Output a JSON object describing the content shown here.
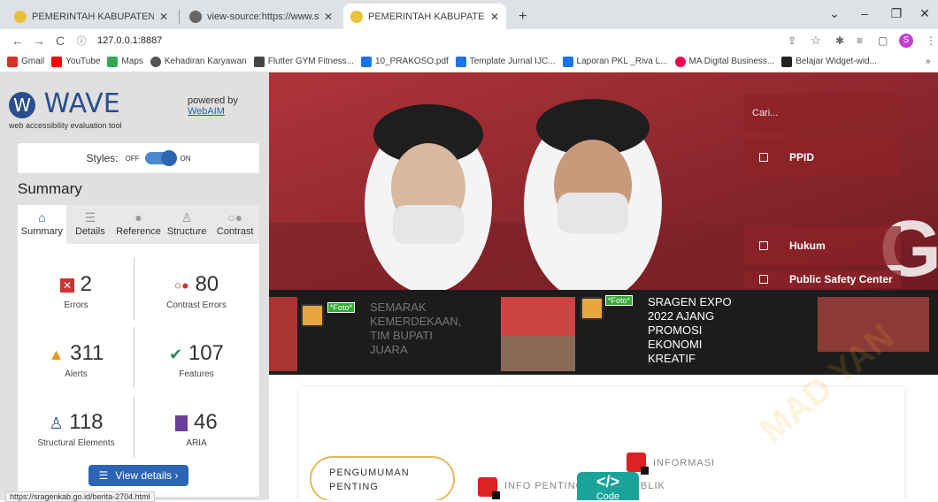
{
  "browser": {
    "tabs": [
      {
        "title": "PEMERINTAH KABUPATEN SRAGE"
      },
      {
        "title": "view-source:https://www.sragenk"
      },
      {
        "title": "PEMERINTAH KABUPATEN SRAGE"
      }
    ],
    "new_tab": "+",
    "url": "127.0.0.1:8887",
    "bookmarks": [
      "Gmail",
      "YouTube",
      "Maps",
      "Kehadiran Karyawan",
      "Flutter GYM Fitness...",
      "10_PRAKOSO.pdf",
      "Template Jurnal IJC...",
      "Laporan PKL _Riva L...",
      "MA Digital Business...",
      "Belajar Widget-wid..."
    ],
    "profile_initial": "S",
    "status_url": "https://sragenkab.go.id/berita-2704.html"
  },
  "wave": {
    "logo": "WAVE",
    "subtitle": "web accessibility evaluation tool",
    "powered_by": "powered by",
    "webaim": "WebAIM",
    "styles_label": "Styles:",
    "off": "OFF",
    "on": "ON",
    "summary_title": "Summary",
    "tabs": [
      "Summary",
      "Details",
      "Reference",
      "Structure",
      "Contrast"
    ],
    "stats": {
      "errors": {
        "value": "2",
        "label": "Errors"
      },
      "contrast": {
        "value": "80",
        "label": "Contrast Errors"
      },
      "alerts": {
        "value": "311",
        "label": "Alerts"
      },
      "features": {
        "value": "107",
        "label": "Features"
      },
      "structural": {
        "value": "118",
        "label": "Structural Elements"
      },
      "aria": {
        "value": "46",
        "label": "ARIA"
      }
    },
    "view_details": "View details ›"
  },
  "site": {
    "search_placeholder": "Cari...",
    "side_items": [
      "PPID",
      "Hukum",
      "Public Safety Center"
    ],
    "foto_tag": "*Foto*",
    "news1": [
      "SEMARAK",
      "KEMERDEKAAN,",
      "TIM BUPATI",
      "JUARA"
    ],
    "news2": [
      "SRAGEN EXPO",
      "2022 AJANG",
      "PROMOSI",
      "EKONOMI",
      "KREATIF"
    ],
    "pengumuman": [
      "PENGUMUMAN",
      "PENTING"
    ],
    "info_penting": "INFO PENTING",
    "informasi": "INFORMASI",
    "blik": "BLIK",
    "code": "Code",
    "code_glyph": "</>",
    "watermark": "MAD YAN"
  }
}
